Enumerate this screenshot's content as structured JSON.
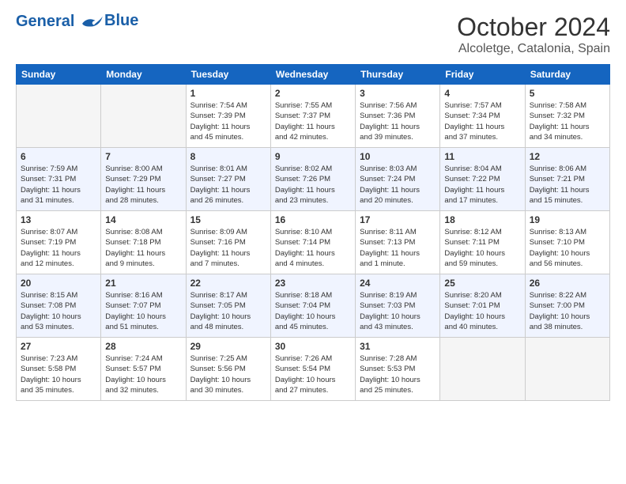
{
  "header": {
    "logo_line1": "General",
    "logo_line2": "Blue",
    "month": "October 2024",
    "location": "Alcoletge, Catalonia, Spain"
  },
  "weekdays": [
    "Sunday",
    "Monday",
    "Tuesday",
    "Wednesday",
    "Thursday",
    "Friday",
    "Saturday"
  ],
  "weeks": [
    [
      {
        "day": "",
        "detail": ""
      },
      {
        "day": "",
        "detail": ""
      },
      {
        "day": "1",
        "detail": "Sunrise: 7:54 AM\nSunset: 7:39 PM\nDaylight: 11 hours\nand 45 minutes."
      },
      {
        "day": "2",
        "detail": "Sunrise: 7:55 AM\nSunset: 7:37 PM\nDaylight: 11 hours\nand 42 minutes."
      },
      {
        "day": "3",
        "detail": "Sunrise: 7:56 AM\nSunset: 7:36 PM\nDaylight: 11 hours\nand 39 minutes."
      },
      {
        "day": "4",
        "detail": "Sunrise: 7:57 AM\nSunset: 7:34 PM\nDaylight: 11 hours\nand 37 minutes."
      },
      {
        "day": "5",
        "detail": "Sunrise: 7:58 AM\nSunset: 7:32 PM\nDaylight: 11 hours\nand 34 minutes."
      }
    ],
    [
      {
        "day": "6",
        "detail": "Sunrise: 7:59 AM\nSunset: 7:31 PM\nDaylight: 11 hours\nand 31 minutes."
      },
      {
        "day": "7",
        "detail": "Sunrise: 8:00 AM\nSunset: 7:29 PM\nDaylight: 11 hours\nand 28 minutes."
      },
      {
        "day": "8",
        "detail": "Sunrise: 8:01 AM\nSunset: 7:27 PM\nDaylight: 11 hours\nand 26 minutes."
      },
      {
        "day": "9",
        "detail": "Sunrise: 8:02 AM\nSunset: 7:26 PM\nDaylight: 11 hours\nand 23 minutes."
      },
      {
        "day": "10",
        "detail": "Sunrise: 8:03 AM\nSunset: 7:24 PM\nDaylight: 11 hours\nand 20 minutes."
      },
      {
        "day": "11",
        "detail": "Sunrise: 8:04 AM\nSunset: 7:22 PM\nDaylight: 11 hours\nand 17 minutes."
      },
      {
        "day": "12",
        "detail": "Sunrise: 8:06 AM\nSunset: 7:21 PM\nDaylight: 11 hours\nand 15 minutes."
      }
    ],
    [
      {
        "day": "13",
        "detail": "Sunrise: 8:07 AM\nSunset: 7:19 PM\nDaylight: 11 hours\nand 12 minutes."
      },
      {
        "day": "14",
        "detail": "Sunrise: 8:08 AM\nSunset: 7:18 PM\nDaylight: 11 hours\nand 9 minutes."
      },
      {
        "day": "15",
        "detail": "Sunrise: 8:09 AM\nSunset: 7:16 PM\nDaylight: 11 hours\nand 7 minutes."
      },
      {
        "day": "16",
        "detail": "Sunrise: 8:10 AM\nSunset: 7:14 PM\nDaylight: 11 hours\nand 4 minutes."
      },
      {
        "day": "17",
        "detail": "Sunrise: 8:11 AM\nSunset: 7:13 PM\nDaylight: 11 hours\nand 1 minute."
      },
      {
        "day": "18",
        "detail": "Sunrise: 8:12 AM\nSunset: 7:11 PM\nDaylight: 10 hours\nand 59 minutes."
      },
      {
        "day": "19",
        "detail": "Sunrise: 8:13 AM\nSunset: 7:10 PM\nDaylight: 10 hours\nand 56 minutes."
      }
    ],
    [
      {
        "day": "20",
        "detail": "Sunrise: 8:15 AM\nSunset: 7:08 PM\nDaylight: 10 hours\nand 53 minutes."
      },
      {
        "day": "21",
        "detail": "Sunrise: 8:16 AM\nSunset: 7:07 PM\nDaylight: 10 hours\nand 51 minutes."
      },
      {
        "day": "22",
        "detail": "Sunrise: 8:17 AM\nSunset: 7:05 PM\nDaylight: 10 hours\nand 48 minutes."
      },
      {
        "day": "23",
        "detail": "Sunrise: 8:18 AM\nSunset: 7:04 PM\nDaylight: 10 hours\nand 45 minutes."
      },
      {
        "day": "24",
        "detail": "Sunrise: 8:19 AM\nSunset: 7:03 PM\nDaylight: 10 hours\nand 43 minutes."
      },
      {
        "day": "25",
        "detail": "Sunrise: 8:20 AM\nSunset: 7:01 PM\nDaylight: 10 hours\nand 40 minutes."
      },
      {
        "day": "26",
        "detail": "Sunrise: 8:22 AM\nSunset: 7:00 PM\nDaylight: 10 hours\nand 38 minutes."
      }
    ],
    [
      {
        "day": "27",
        "detail": "Sunrise: 7:23 AM\nSunset: 5:58 PM\nDaylight: 10 hours\nand 35 minutes."
      },
      {
        "day": "28",
        "detail": "Sunrise: 7:24 AM\nSunset: 5:57 PM\nDaylight: 10 hours\nand 32 minutes."
      },
      {
        "day": "29",
        "detail": "Sunrise: 7:25 AM\nSunset: 5:56 PM\nDaylight: 10 hours\nand 30 minutes."
      },
      {
        "day": "30",
        "detail": "Sunrise: 7:26 AM\nSunset: 5:54 PM\nDaylight: 10 hours\nand 27 minutes."
      },
      {
        "day": "31",
        "detail": "Sunrise: 7:28 AM\nSunset: 5:53 PM\nDaylight: 10 hours\nand 25 minutes."
      },
      {
        "day": "",
        "detail": ""
      },
      {
        "day": "",
        "detail": ""
      }
    ]
  ]
}
